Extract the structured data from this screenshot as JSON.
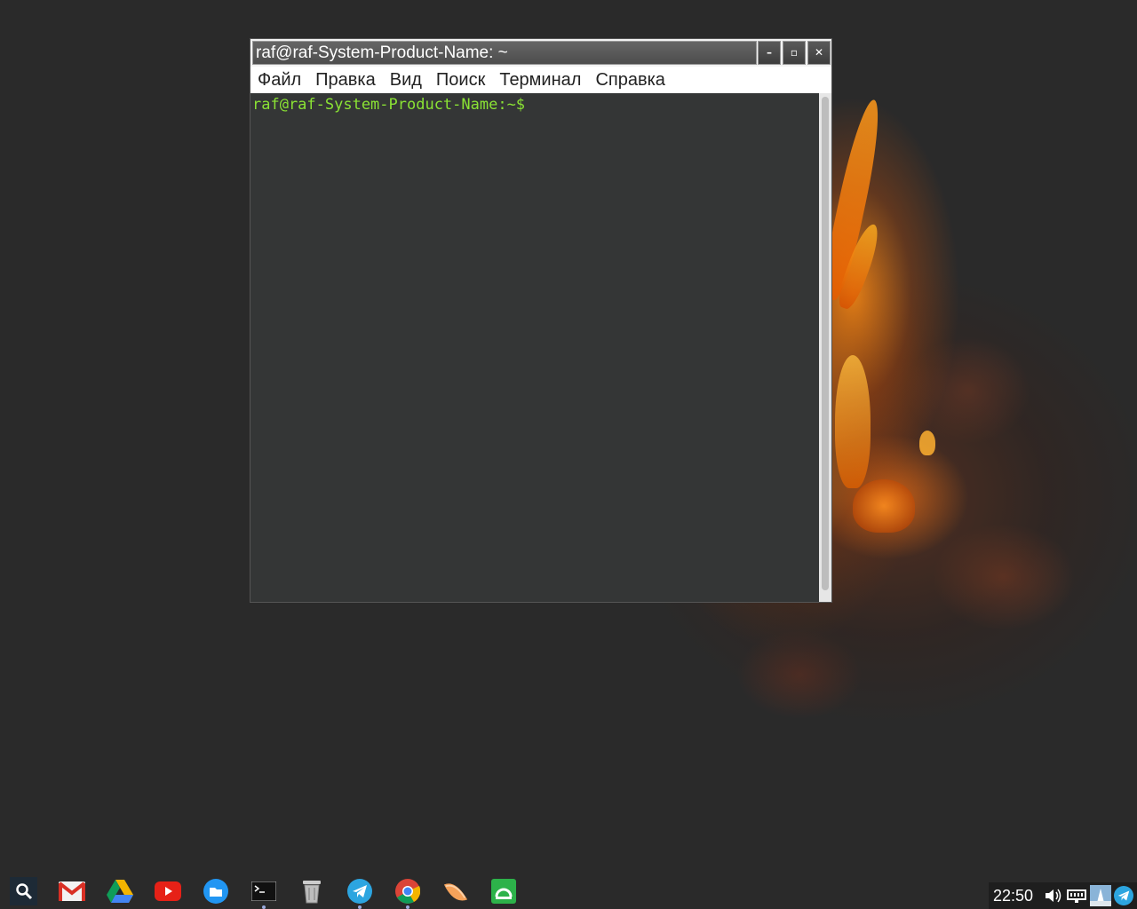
{
  "window": {
    "title": "raf@raf-System-Product-Name: ~",
    "minimize_label": "–",
    "maximize_label": "▫",
    "close_label": "✕"
  },
  "menu": {
    "items": [
      "Файл",
      "Правка",
      "Вид",
      "Поиск",
      "Терминал",
      "Справка"
    ]
  },
  "terminal": {
    "prompt": "raf@raf-System-Product-Name:~$"
  },
  "shelf": {
    "apps": [
      "search-icon",
      "gmail-icon",
      "google-drive-icon",
      "youtube-icon",
      "files-icon",
      "terminal-icon",
      "trash-icon",
      "telegram-icon",
      "chrome-icon",
      "clementine-icon",
      "torrent-icon"
    ]
  },
  "tray": {
    "clock": "22:50",
    "icons": [
      "volume-icon",
      "network-icon",
      "user-avatar-icon",
      "telegram-tray-icon"
    ]
  },
  "colors": {
    "prompt": "#8ae234",
    "terminal_bg": "#262828",
    "titlebar": "#555555"
  }
}
